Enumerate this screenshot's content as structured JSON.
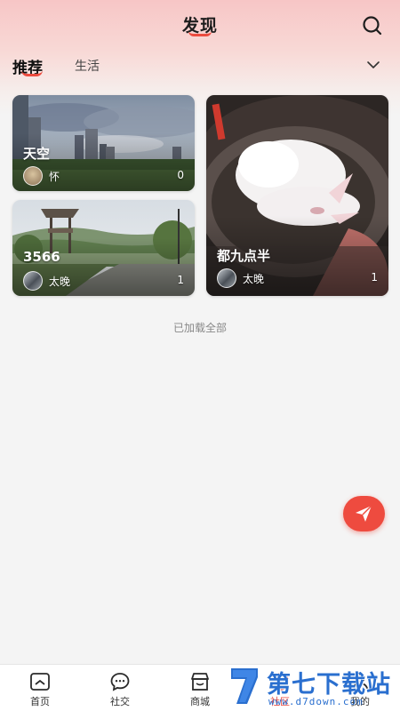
{
  "header": {
    "title": "发现",
    "tabs": [
      {
        "label": "推荐",
        "active": true
      },
      {
        "label": "生活",
        "active": false
      }
    ]
  },
  "posts": [
    {
      "title": "天空",
      "user": "怀",
      "count": "0",
      "image": "city-sky-photo"
    },
    {
      "title": "3566",
      "user": "太晚",
      "count": "1",
      "image": "park-pavilion-photo"
    },
    {
      "title": "都九点半",
      "user": "太晚",
      "count": "1",
      "image": "white-kitten-photo"
    }
  ],
  "list_footer": "已加载全部",
  "bottom_nav": [
    {
      "label": "首页",
      "icon": "home-icon"
    },
    {
      "label": "社交",
      "icon": "chat-bubble-icon"
    },
    {
      "label": "商城",
      "icon": "store-icon"
    },
    {
      "label": "社区",
      "icon": "community-icon",
      "active": true
    },
    {
      "label": "我的",
      "icon": "user-icon"
    }
  ],
  "watermark": {
    "title": "第七下载站",
    "url": "www.d7down.com"
  },
  "colors": {
    "accent": "#ec4b3f",
    "fab": "#ee4b3f",
    "watermark": "#2a6fcf"
  }
}
